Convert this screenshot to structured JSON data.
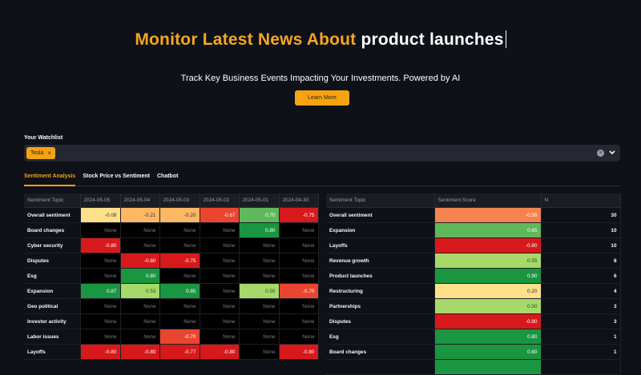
{
  "hero": {
    "title_accent": "Monitor Latest News About",
    "title_plain": "product launches",
    "subtitle": "Track Key Business Events Impacting Your Investments. Powered by AI",
    "cta": "Learn More"
  },
  "watchlist": {
    "label": "Your Watchlist",
    "chips": [
      "Tesla"
    ],
    "remove_glyph": "×",
    "clear_glyph": "×"
  },
  "tabs": [
    "Sentiment Analysis",
    "Stock Price vs Sentiment",
    "Chatbot"
  ],
  "colors": {
    "accent": "#f5a312",
    "dark_red": "#d7191c",
    "red": "#e9452f",
    "light_red": "#f6834f",
    "pale_orange": "#fdb865",
    "pale_yellow": "#fee08b",
    "light_green": "#a6d96a",
    "green": "#5fb95a",
    "dark_green": "#1a9641"
  },
  "sentiment_by_date": {
    "columns": [
      "Sentiment Topic",
      "2024-05-05",
      "2024-05-04",
      "2024-05-03",
      "2024-05-02",
      "2024-05-01",
      "2024-04-30"
    ],
    "rows": [
      {
        "topic": "Overall sentiment",
        "cells": [
          "-0.08",
          "-0.21",
          "-0.20",
          "-0.67",
          "0.70",
          "-0.75"
        ]
      },
      {
        "topic": "Board changes",
        "cells": [
          "None",
          "None",
          "None",
          "None",
          "0.80",
          "None"
        ]
      },
      {
        "topic": "Cyber security",
        "cells": [
          "-0.80",
          "None",
          "None",
          "None",
          "None",
          "None"
        ]
      },
      {
        "topic": "Disputes",
        "cells": [
          "None",
          "-0.80",
          "-0.75",
          "None",
          "None",
          "None"
        ]
      },
      {
        "topic": "Esg",
        "cells": [
          "None",
          "0.80",
          "None",
          "None",
          "None",
          "None"
        ]
      },
      {
        "topic": "Expansion",
        "cells": [
          "0.87",
          "0.53",
          "0.85",
          "None",
          "0.50",
          "-0.70"
        ]
      },
      {
        "topic": "Geo political",
        "cells": [
          "None",
          "None",
          "None",
          "None",
          "None",
          "None"
        ]
      },
      {
        "topic": "Investor activity",
        "cells": [
          "None",
          "None",
          "None",
          "None",
          "None",
          "None"
        ]
      },
      {
        "topic": "Labor issues",
        "cells": [
          "None",
          "None",
          "-0.70",
          "None",
          "None",
          "None"
        ]
      },
      {
        "topic": "Layoffs",
        "cells": [
          "-0.80",
          "-0.80",
          "-0.77",
          "-0.80",
          "None",
          "-0.80"
        ]
      }
    ]
  },
  "sentiment_summary": {
    "columns": [
      "Sentiment Topic",
      "Sentiment Score",
      "N"
    ],
    "rows": [
      {
        "topic": "Overall sentiment",
        "score": "-0.50",
        "n": "30"
      },
      {
        "topic": "Expansion",
        "score": "0.65",
        "n": "10"
      },
      {
        "topic": "Layoffs",
        "score": "-0.80",
        "n": "10"
      },
      {
        "topic": "Revenue growth",
        "score": "0.55",
        "n": "8"
      },
      {
        "topic": "Product launches",
        "score": "0.90",
        "n": "6"
      },
      {
        "topic": "Restructuring",
        "score": "0.20",
        "n": "4"
      },
      {
        "topic": "Partnerships",
        "score": "0.50",
        "n": "3"
      },
      {
        "topic": "Disputes",
        "score": "-0.80",
        "n": "3"
      },
      {
        "topic": "Esg",
        "score": "0.80",
        "n": "1"
      },
      {
        "topic": "Board changes",
        "score": "0.80",
        "n": "1"
      },
      {
        "topic": "",
        "score": "",
        "n": ""
      }
    ]
  }
}
